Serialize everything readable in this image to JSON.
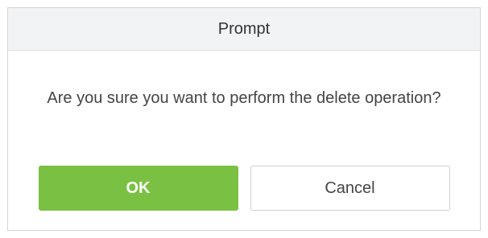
{
  "dialog": {
    "title": "Prompt",
    "message": "Are you sure you want to perform the delete operation?",
    "ok_label": "OK",
    "cancel_label": "Cancel"
  },
  "colors": {
    "header_bg": "#f2f3f5",
    "ok_button": "#7ac143",
    "border": "#d4d4d4"
  }
}
